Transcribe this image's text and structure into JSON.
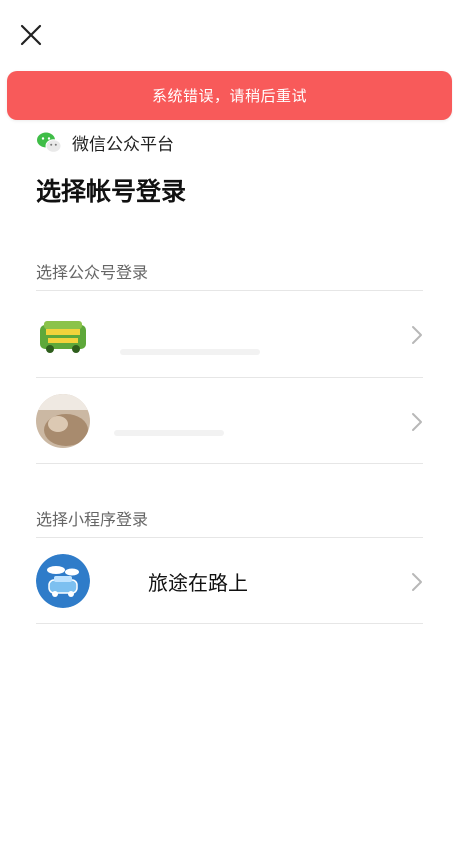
{
  "toast": {
    "message": "系统错误，请稍后重试"
  },
  "brand": {
    "name": "微信公众平台"
  },
  "title": "选择帐号登录",
  "sections": {
    "official": {
      "label": "选择公众号登录",
      "items": [
        {
          "name": ""
        },
        {
          "name": ""
        }
      ]
    },
    "mini": {
      "label": "选择小程序登录",
      "items": [
        {
          "name": "旅途在路上"
        }
      ]
    }
  },
  "icons": {
    "close": "close-icon",
    "brand": "wechat-icon",
    "chevron": "chevron-right-icon"
  },
  "colors": {
    "toast_bg": "#f85a5a",
    "wechat_green": "#3fbd47"
  }
}
